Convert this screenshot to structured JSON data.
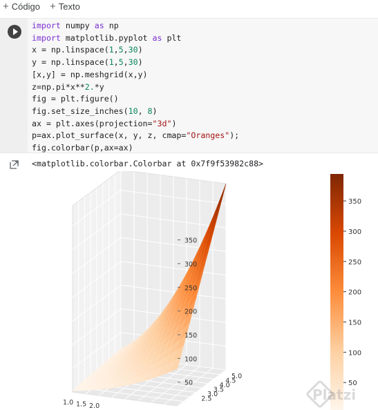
{
  "toolbar": {
    "code_label": "Código",
    "text_label": "Texto"
  },
  "cell": {
    "lines": [
      [
        [
          "kw",
          "import"
        ],
        [
          "t",
          " numpy "
        ],
        [
          "kw",
          "as"
        ],
        [
          "t",
          " np"
        ]
      ],
      [
        [
          "kw",
          "import"
        ],
        [
          "t",
          " matplotlib.pyplot "
        ],
        [
          "kw",
          "as"
        ],
        [
          "t",
          " plt"
        ]
      ],
      [
        [
          "t",
          "x = np.linspace("
        ],
        [
          "num",
          "1"
        ],
        [
          "t",
          ","
        ],
        [
          "num",
          "5"
        ],
        [
          "t",
          ","
        ],
        [
          "num",
          "30"
        ],
        [
          "t",
          ")"
        ]
      ],
      [
        [
          "t",
          "y = np.linspace("
        ],
        [
          "num",
          "1"
        ],
        [
          "t",
          ","
        ],
        [
          "num",
          "5"
        ],
        [
          "t",
          ","
        ],
        [
          "num",
          "30"
        ],
        [
          "t",
          ")"
        ]
      ],
      [
        [
          "t",
          "[x,y] = np.meshgrid(x,y)"
        ]
      ],
      [
        [
          "t",
          "z=np.pi*x**"
        ],
        [
          "num",
          "2."
        ],
        [
          "t",
          "*y"
        ]
      ],
      [
        [
          "t",
          "fig = plt.figure()"
        ]
      ],
      [
        [
          "t",
          "fig.set_size_inches("
        ],
        [
          "num",
          "10"
        ],
        [
          "t",
          ", "
        ],
        [
          "num",
          "8"
        ],
        [
          "t",
          ")"
        ]
      ],
      [
        [
          "t",
          "ax = plt.axes(projection="
        ],
        [
          "str",
          "\"3d\""
        ],
        [
          "t",
          ")"
        ]
      ],
      [
        [
          "t",
          "p=ax.plot_surface(x, y, z, cmap="
        ],
        [
          "str",
          "\"Oranges\""
        ],
        [
          "t",
          ");"
        ]
      ],
      [
        [
          "t",
          "fig.colorbar(p,ax=ax)"
        ]
      ]
    ]
  },
  "output": {
    "text": "<matplotlib.colorbar.Colorbar at 0x7f9f53982c88>"
  },
  "chart_data": {
    "type": "surface3d",
    "function": "z = pi * x^2 * y",
    "colormap": "Oranges",
    "x_range": [
      1,
      5
    ],
    "y_range": [
      1,
      5
    ],
    "z_range": [
      0,
      393
    ],
    "z_ticks": [
      "50",
      "100",
      "150",
      "200",
      "250",
      "300",
      "350"
    ],
    "y_ticks": [
      "2.5",
      "3.0",
      "3.5",
      "4.0",
      "4.5",
      "5.0"
    ],
    "x_ticks": [
      "1.0",
      "1.5",
      "2.0"
    ],
    "colorbar_ticks": [
      "100",
      "150",
      "200",
      "250",
      "300",
      "350"
    ],
    "colorbar_partial_tick": "50",
    "colors": {
      "low": "#fff5eb",
      "mid": "#f16913",
      "high": "#7f2704"
    }
  },
  "watermark": {
    "text": "Platzi"
  }
}
